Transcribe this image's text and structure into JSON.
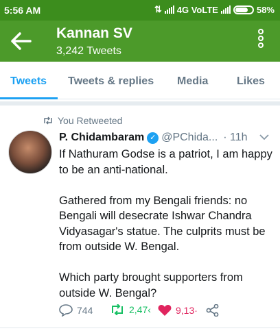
{
  "status_bar": {
    "time": "5:56 AM",
    "network": "4G VoLTE",
    "battery": "58%"
  },
  "header": {
    "name": "Kannan SV",
    "tweet_count": "3,242 Tweets"
  },
  "tabs": [
    {
      "label": "Tweets",
      "active": true
    },
    {
      "label": "Tweets & replies",
      "active": false
    },
    {
      "label": "Media",
      "active": false
    },
    {
      "label": "Likes",
      "active": false
    }
  ],
  "tweet": {
    "retweeted_label": "You Retweeted",
    "author_name": "P. Chidambaram",
    "handle": "@PChida...",
    "time": "· 11h",
    "text": "If Nathuram Godse is a patriot, I am happy to be an anti-national.\n\nGathered from my Bengali friends: no Bengali will desecrate Ishwar Chandra Vidyasagar's statue. The culprits must be from outside W. Bengal.\n\nWhich party brought supporters from outside W. Bengal?",
    "replies": "744",
    "retweets": "2,47‹",
    "likes": "9,13·"
  },
  "colors": {
    "status_bar": "#3c8d1d",
    "header": "#4c9a2a",
    "accent": "#1da1f2",
    "retweet": "#17bf63",
    "like": "#e0245e"
  }
}
